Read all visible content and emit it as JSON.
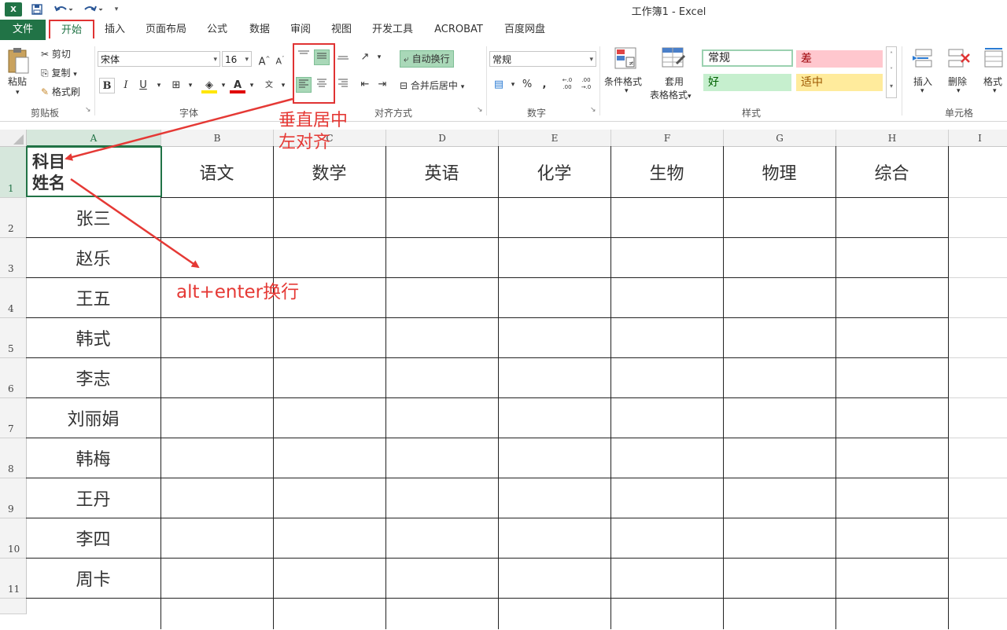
{
  "window": {
    "title": "工作簿1 - Excel",
    "logo": "X"
  },
  "quick_access": [
    {
      "name": "save-icon",
      "glyph": "🖫"
    },
    {
      "name": "undo-icon",
      "glyph": "↶"
    },
    {
      "name": "redo-icon",
      "glyph": "↷"
    },
    {
      "name": "customize-icon",
      "glyph": "▾"
    }
  ],
  "tabs": [
    "文件",
    "开始",
    "插入",
    "页面布局",
    "公式",
    "数据",
    "审阅",
    "视图",
    "开发工具",
    "ACROBAT",
    "百度网盘"
  ],
  "ribbon": {
    "clipboard": {
      "paste": "粘贴",
      "cut": "剪切",
      "copy": "复制",
      "format_painter": "格式刷",
      "label": "剪贴板"
    },
    "font": {
      "name": "宋体",
      "size": "16",
      "bold": "B",
      "italic": "I",
      "underline": "U",
      "label": "字体"
    },
    "alignment": {
      "wrap_text": "自动换行",
      "merge_center": "合并后居中",
      "label": "对齐方式"
    },
    "number": {
      "format": "常规",
      "percent": "%",
      "comma": ",",
      "inc_decimal": "←.0 .00",
      "dec_decimal": ".00 →.0",
      "label": "数字"
    },
    "styles": {
      "conditional_format": "条件格式",
      "table_format_1": "套用",
      "table_format_2": "表格格式",
      "normal": "常规",
      "bad": "差",
      "good": "好",
      "neutral": "适中",
      "label": "样式",
      "colors": {
        "normal_border": "#9bd1b0",
        "bad_bg": "#ffc7ce",
        "bad_fg": "#9c0006",
        "good_bg": "#c6efce",
        "good_fg": "#006100",
        "neutral_bg": "#ffeb9c",
        "neutral_fg": "#9c5700"
      }
    },
    "cells": {
      "insert": "插入",
      "delete": "删除",
      "format": "格式",
      "label": "单元格"
    }
  },
  "sheet": {
    "columns": [
      "A",
      "B",
      "C",
      "D",
      "E",
      "F",
      "G",
      "H",
      "I"
    ],
    "header_row": {
      "a1_line1": "科目",
      "a1_line2": "姓名",
      "subjects": [
        "语文",
        "数学",
        "英语",
        "化学",
        "生物",
        "物理",
        "综合"
      ]
    },
    "rows": [
      "1",
      "2",
      "3",
      "4",
      "5",
      "6",
      "7",
      "8",
      "9",
      "10",
      "11"
    ],
    "names": [
      "张三",
      "赵乐",
      "王五",
      "韩式",
      "李志",
      "刘丽娟",
      "韩梅",
      "王丹",
      "李四",
      "周卡"
    ]
  },
  "annotations": {
    "align_line1": "垂直居中",
    "align_line2": "左对齐",
    "wrap_hint": "alt+enter换行",
    "accent": "#e53935"
  },
  "colors": {
    "excel_green": "#217346"
  }
}
